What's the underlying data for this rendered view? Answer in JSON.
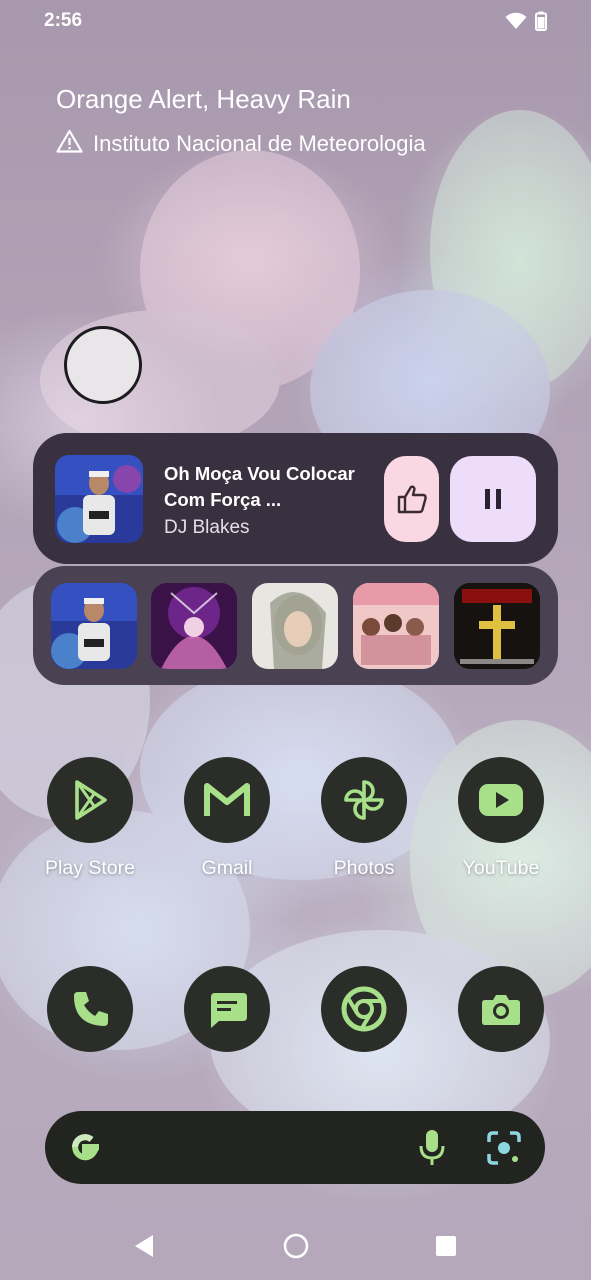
{
  "status_bar": {
    "time": "2:56",
    "wifi_icon": "wifi-icon",
    "battery_icon": "battery-icon"
  },
  "weather_alert": {
    "title": "Orange Alert, Heavy Rain",
    "source": "Instituto Nacional de Meteorologia",
    "icon": "warning-icon"
  },
  "media_player": {
    "title": "Oh Moça Vou Colocar Com Força ...",
    "artist": "DJ Blakes",
    "like_icon": "thumbs-up-icon",
    "pause_icon": "pause-icon"
  },
  "recent_tracks": [
    "album-art-1",
    "album-art-2",
    "album-art-3",
    "album-art-4",
    "album-art-5"
  ],
  "apps_row": [
    {
      "label": "Play Store",
      "icon": "play-store-icon"
    },
    {
      "label": "Gmail",
      "icon": "gmail-icon"
    },
    {
      "label": "Photos",
      "icon": "photos-icon"
    },
    {
      "label": "YouTube",
      "icon": "youtube-icon"
    }
  ],
  "dock": [
    {
      "icon": "phone-icon"
    },
    {
      "icon": "messages-icon"
    },
    {
      "icon": "chrome-icon"
    },
    {
      "icon": "camera-icon"
    }
  ],
  "search_bar": {
    "logo": "google-logo-icon",
    "mic_icon": "mic-icon",
    "lens_icon": "lens-icon"
  },
  "nav_bar": {
    "back": "back-icon",
    "home": "home-icon",
    "recents": "recents-icon"
  },
  "colors": {
    "accent_green": "#a8e08a",
    "icon_bg": "#2b2e28",
    "media_card": "#3a3140",
    "like_bg": "#f9d8e3",
    "pause_bg": "#eedcfb"
  }
}
